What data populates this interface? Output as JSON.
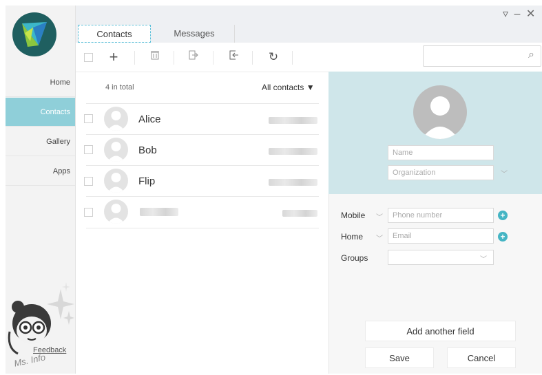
{
  "window": {
    "controls": "▿ – ✕"
  },
  "tabs": [
    {
      "label": "Contacts"
    },
    {
      "label": "Messages"
    }
  ],
  "sidebar": {
    "items": [
      {
        "label": "Home"
      },
      {
        "label": "Contacts"
      },
      {
        "label": "Gallery"
      },
      {
        "label": "Apps"
      }
    ],
    "feedback_label": "Feedback",
    "mascot_text": "Ms. Info"
  },
  "toolbar": {
    "icons": [
      "checkbox-icon",
      "add-icon",
      "delete-icon",
      "export-icon",
      "import-icon",
      "refresh-icon"
    ],
    "search_placeholder": "",
    "search_icon": "⌕"
  },
  "list": {
    "count": "4 in total",
    "filter": "All contacts ▼",
    "contacts": [
      {
        "name": "Alice"
      },
      {
        "name": "Bob"
      },
      {
        "name": "Flip"
      },
      {
        "name": ""
      }
    ]
  },
  "detail": {
    "name_placeholder": "Name",
    "org_placeholder": "Organization",
    "phone_label": "Mobile",
    "phone_placeholder": "Phone number",
    "email_label": "Home",
    "email_placeholder": "Email",
    "groups_label": "Groups",
    "add_field": "Add another field",
    "save": "Save",
    "cancel": "Cancel"
  },
  "colors": {
    "accent": "#8fcfd9",
    "header_panel": "#cfe6ea",
    "plus": "#45b5c4"
  }
}
